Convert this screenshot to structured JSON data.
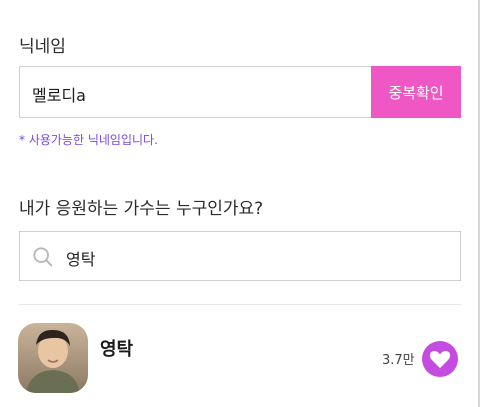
{
  "nickname": {
    "label": "닉네임",
    "value": "멜로디a",
    "check_button": "중복확인",
    "message": "* 사용가능한 닉네임입니다."
  },
  "singer_search": {
    "label": "내가 응원하는 가수는 누구인가요?",
    "query": "영탁"
  },
  "results": [
    {
      "name": "영탁",
      "likes": "3.7만"
    }
  ],
  "colors": {
    "accent_pink": "#ef58c4",
    "message_purple": "#7b48e8",
    "heart_purple": "#c54ce0"
  }
}
